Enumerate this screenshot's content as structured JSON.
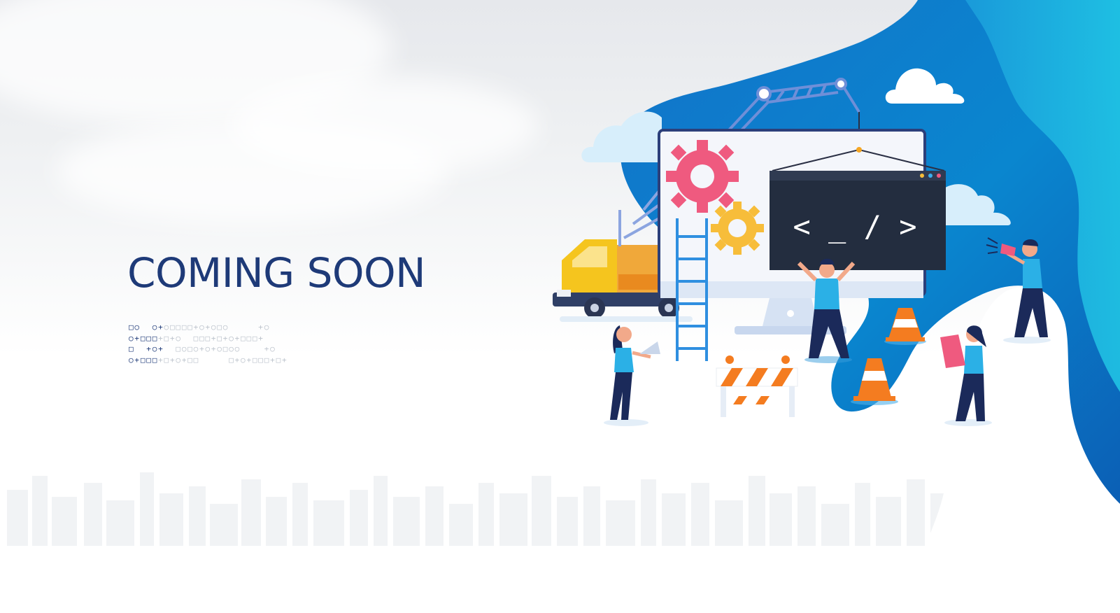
{
  "heading": {
    "text": "COMING SOON"
  },
  "code_screen": {
    "text": "< _ / >"
  },
  "symbol_pattern": {
    "rows": [
      {
        "dark": "□○  ○+",
        "light": "○□□□□+○+○□○     +○"
      },
      {
        "dark": "○+□□□",
        "light": "+□+○  □□□+□+○+□□□+"
      },
      {
        "dark": "□  +○+",
        "light": "  □○□○+○+○□○○    +○"
      },
      {
        "dark": "○+□□□",
        "light": "+□+○+□□     □+○+□□□+□+"
      }
    ]
  },
  "colors": {
    "brand_navy": "#1e3a78",
    "wave_blue": "#0a7fc9",
    "wave_cyan": "#19c3e3",
    "gear_pink": "#ef5a7f",
    "gear_yellow": "#f7bd3a",
    "cone_orange": "#f47c20",
    "truck_yellow": "#f5c51e",
    "monitor_dark": "#232d3f"
  },
  "icons": [
    "gear-icon",
    "code-window-icon",
    "cloud-icon",
    "traffic-cone-icon",
    "megaphone-icon",
    "laptop-icon",
    "crane-icon",
    "truck-icon",
    "ladder-icon",
    "road-barrier-icon"
  ]
}
